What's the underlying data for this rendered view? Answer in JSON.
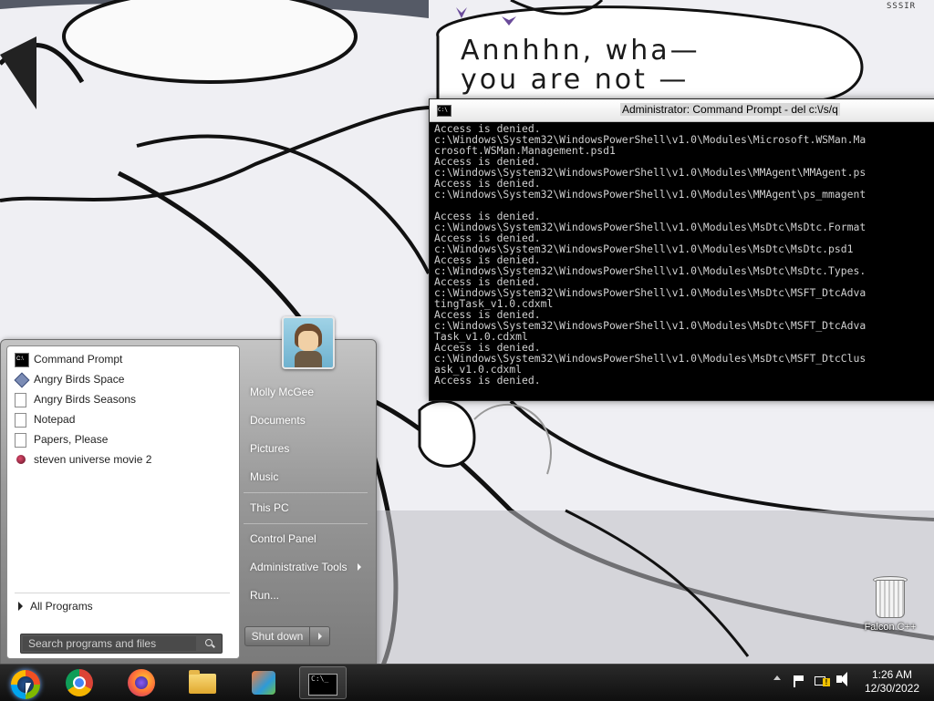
{
  "wallpaper": {
    "signature": "SSSIR",
    "speech_line1": "Annhhn, wha—",
    "speech_line2": "you are not —"
  },
  "cmd_window": {
    "title": "Administrator: Command Prompt - del  c:\\/s/q",
    "lines": [
      "Access is denied.",
      "c:\\Windows\\System32\\WindowsPowerShell\\v1.0\\Modules\\Microsoft.WSMan.Ma",
      "crosoft.WSMan.Management.psd1",
      "Access is denied.",
      "c:\\Windows\\System32\\WindowsPowerShell\\v1.0\\Modules\\MMAgent\\MMAgent.ps",
      "Access is denied.",
      "c:\\Windows\\System32\\WindowsPowerShell\\v1.0\\Modules\\MMAgent\\ps_mmagent",
      "",
      "Access is denied.",
      "c:\\Windows\\System32\\WindowsPowerShell\\v1.0\\Modules\\MsDtc\\MsDtc.Format",
      "Access is denied.",
      "c:\\Windows\\System32\\WindowsPowerShell\\v1.0\\Modules\\MsDtc\\MsDtc.psd1",
      "Access is denied.",
      "c:\\Windows\\System32\\WindowsPowerShell\\v1.0\\Modules\\MsDtc\\MsDtc.Types.",
      "Access is denied.",
      "c:\\Windows\\System32\\WindowsPowerShell\\v1.0\\Modules\\MsDtc\\MSFT_DtcAdva",
      "tingTask_v1.0.cdxml",
      "Access is denied.",
      "c:\\Windows\\System32\\WindowsPowerShell\\v1.0\\Modules\\MsDtc\\MSFT_DtcAdva",
      "Task_v1.0.cdxml",
      "Access is denied.",
      "c:\\Windows\\System32\\WindowsPowerShell\\v1.0\\Modules\\MsDtc\\MSFT_DtcClus",
      "ask_v1.0.cdxml",
      "Access is denied."
    ]
  },
  "start_menu": {
    "programs": [
      {
        "label": "Command Prompt",
        "icon": "command-prompt-icon"
      },
      {
        "label": "Angry Birds Space",
        "icon": "angry-birds-space-icon"
      },
      {
        "label": "Angry Birds Seasons",
        "icon": "document-icon"
      },
      {
        "label": "Notepad",
        "icon": "document-icon"
      },
      {
        "label": "Papers, Please",
        "icon": "document-icon"
      },
      {
        "label": "steven universe movie 2",
        "icon": "gem-icon"
      }
    ],
    "all_programs": "All Programs",
    "search_placeholder": "Search programs and files",
    "user_name": "Molly McGee",
    "right_items": {
      "documents": "Documents",
      "pictures": "Pictures",
      "music": "Music",
      "this_pc": "This PC",
      "control_panel": "Control Panel",
      "admin_tools": "Administrative Tools",
      "run": "Run..."
    },
    "shutdown": "Shut down"
  },
  "desktop": {
    "recycle_label": "Falcon C++"
  },
  "taskbar": {
    "items": [
      "start-orb",
      "chrome-icon",
      "firefox-icon",
      "file-explorer-icon",
      "control-panel-icon",
      "command-prompt-icon"
    ],
    "time": "1:26 AM",
    "date": "12/30/2022"
  }
}
